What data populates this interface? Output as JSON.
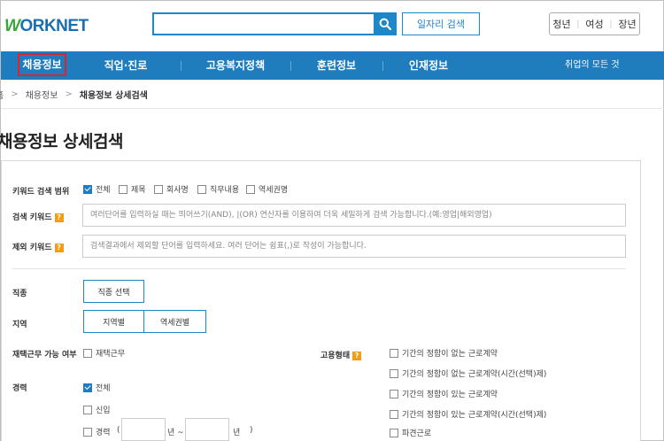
{
  "header": {
    "logo_prefix": "W",
    "logo_text": "ORKNET",
    "search_placeholder": "",
    "job_search_label": "일자리 검색",
    "user_groups": [
      "청년",
      "여성",
      "장년"
    ]
  },
  "nav": {
    "items": [
      "채용정보",
      "직업·진로",
      "고용복지정책",
      "훈련정보",
      "인재정보"
    ],
    "all_services": "취업의 모든 것"
  },
  "breadcrumb": {
    "home": "홈",
    "level1": "채용정보",
    "current": "채용정보 상세검색"
  },
  "page_title": "채용정보 상세검색",
  "form": {
    "keyword_scope": {
      "label": "키워드 검색 범위",
      "options": [
        {
          "label": "전체",
          "checked": true
        },
        {
          "label": "제목",
          "checked": false
        },
        {
          "label": "회사명",
          "checked": false
        },
        {
          "label": "직무내용",
          "checked": false
        },
        {
          "label": "역세권명",
          "checked": false
        }
      ]
    },
    "search_keyword": {
      "label": "검색 키워드",
      "placeholder": "여러단어를 입력하실 때는 띄어쓰기(AND), |(OR) 연산자를 이용하여 더욱 세밀하게 검색 가능합니다.(예:영업|해외영업)"
    },
    "exclude_keyword": {
      "label": "제외 키워드",
      "placeholder": "검색결과에서 제외할 단어를 입력하세요. 여러 단어는 쉼표(,)로 작성이 가능합니다."
    },
    "job_type": {
      "label": "직종",
      "button": "직종 선택"
    },
    "region": {
      "label": "지역",
      "buttons": [
        "지역별",
        "역세권별"
      ]
    },
    "remote": {
      "label": "재택근무 가능 여부",
      "option": "재택근무",
      "checked": false
    },
    "career": {
      "label": "경력",
      "options": [
        {
          "label": "전체",
          "checked": true
        },
        {
          "label": "신입",
          "checked": false
        },
        {
          "label": "경력",
          "checked": false
        }
      ],
      "paren_open": "(",
      "year1": "년 ~",
      "year2": "년",
      "paren_close": ")"
    },
    "employment_type": {
      "label": "고용형태",
      "options": [
        {
          "label": "기간의 정함이 없는 근로계약",
          "checked": false
        },
        {
          "label": "기간의 정함이 없는 근로계약(시간(선택)제)",
          "checked": false
        },
        {
          "label": "기간의 정함이 있는 근로계약",
          "checked": false
        },
        {
          "label": "기간의 정함이 있는 근로계약(시간(선택)제)",
          "checked": false
        },
        {
          "label": "파견근로",
          "checked": false
        }
      ]
    },
    "help_icon": "?"
  }
}
